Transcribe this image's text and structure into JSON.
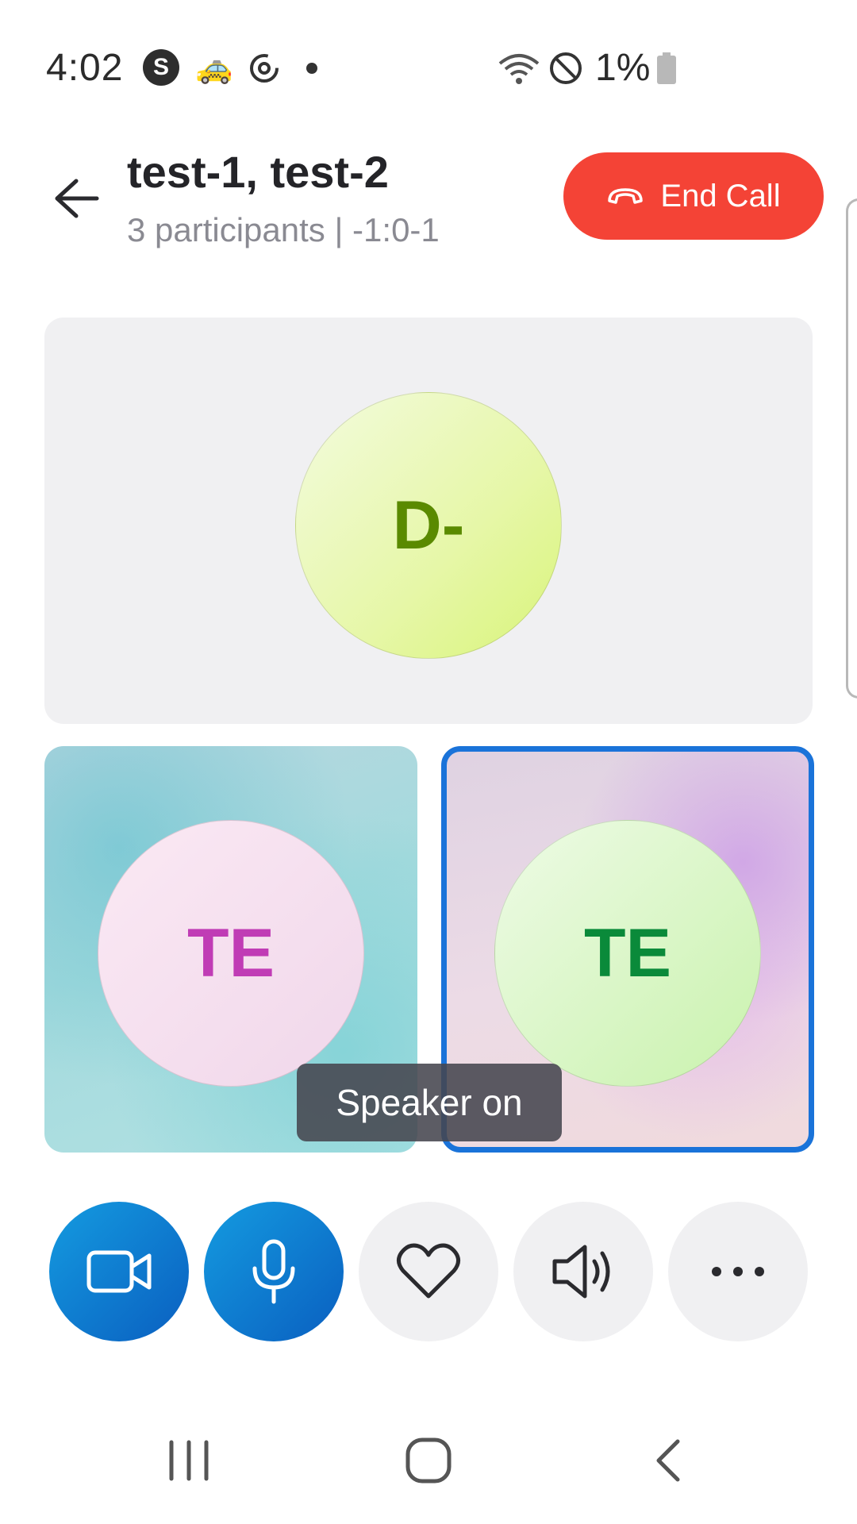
{
  "status_bar": {
    "time": "4:02",
    "skype_letter": "S",
    "battery": "1%",
    "icons": [
      "skype-icon",
      "taxi-icon",
      "sync-icon",
      "notification-dot-icon",
      "wifi-icon",
      "do-not-disturb-icon",
      "battery-icon"
    ]
  },
  "header": {
    "title": "test-1, test-2",
    "subtitle": "3 participants | -1:0-1",
    "end_call_label": "End Call",
    "colors": {
      "end_call": "#f44336"
    }
  },
  "participants": [
    {
      "initials": "D-",
      "color": "#5a8a00",
      "active": false
    },
    {
      "initials": "TE",
      "color": "#c03cb5",
      "active": false
    },
    {
      "initials": "TE",
      "color": "#0a8a3a",
      "active": true
    }
  ],
  "toast": {
    "text": "Speaker on"
  },
  "controls": [
    {
      "name": "video",
      "icon": "video-camera-icon",
      "active": true
    },
    {
      "name": "microphone",
      "icon": "microphone-icon",
      "active": true
    },
    {
      "name": "reactions",
      "icon": "heart-icon",
      "active": false
    },
    {
      "name": "speaker",
      "icon": "speaker-icon",
      "active": false
    },
    {
      "name": "more",
      "icon": "more-icon",
      "active": false
    }
  ],
  "colors": {
    "accent": "#1a73d9",
    "active_control": "#0a6fd0"
  }
}
